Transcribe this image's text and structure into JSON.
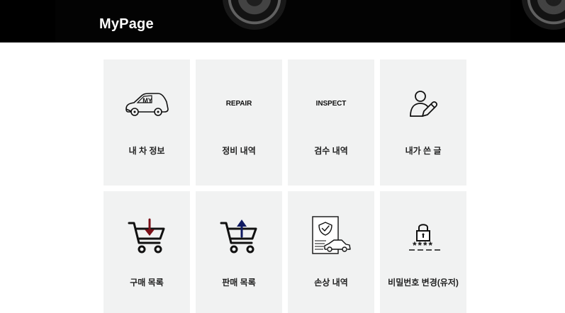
{
  "header": {
    "title": "MyPage"
  },
  "menu": {
    "items": [
      {
        "label": "내 차 정보",
        "icon": "car-icon",
        "icon_text": "MY"
      },
      {
        "label": "정비 내역",
        "icon": "repair-text-icon",
        "icon_text": "REPAIR"
      },
      {
        "label": "검수 내역",
        "icon": "inspect-text-icon",
        "icon_text": "INSPECT"
      },
      {
        "label": "내가 쓴 글",
        "icon": "user-edit-icon"
      },
      {
        "label": "구매 목록",
        "icon": "cart-down-icon"
      },
      {
        "label": "판매 목록",
        "icon": "cart-up-icon"
      },
      {
        "label": "손상 내역",
        "icon": "damage-report-icon"
      },
      {
        "label": "비밀번호 변경(유저)",
        "icon": "lock-password-icon",
        "icon_text": "****"
      }
    ]
  },
  "colors": {
    "header_background": "#000000",
    "card_background": "#f1f2f2",
    "text_dark": "#222222",
    "cart_down_arrow": "#7a1018",
    "cart_up_arrow": "#101a62"
  }
}
